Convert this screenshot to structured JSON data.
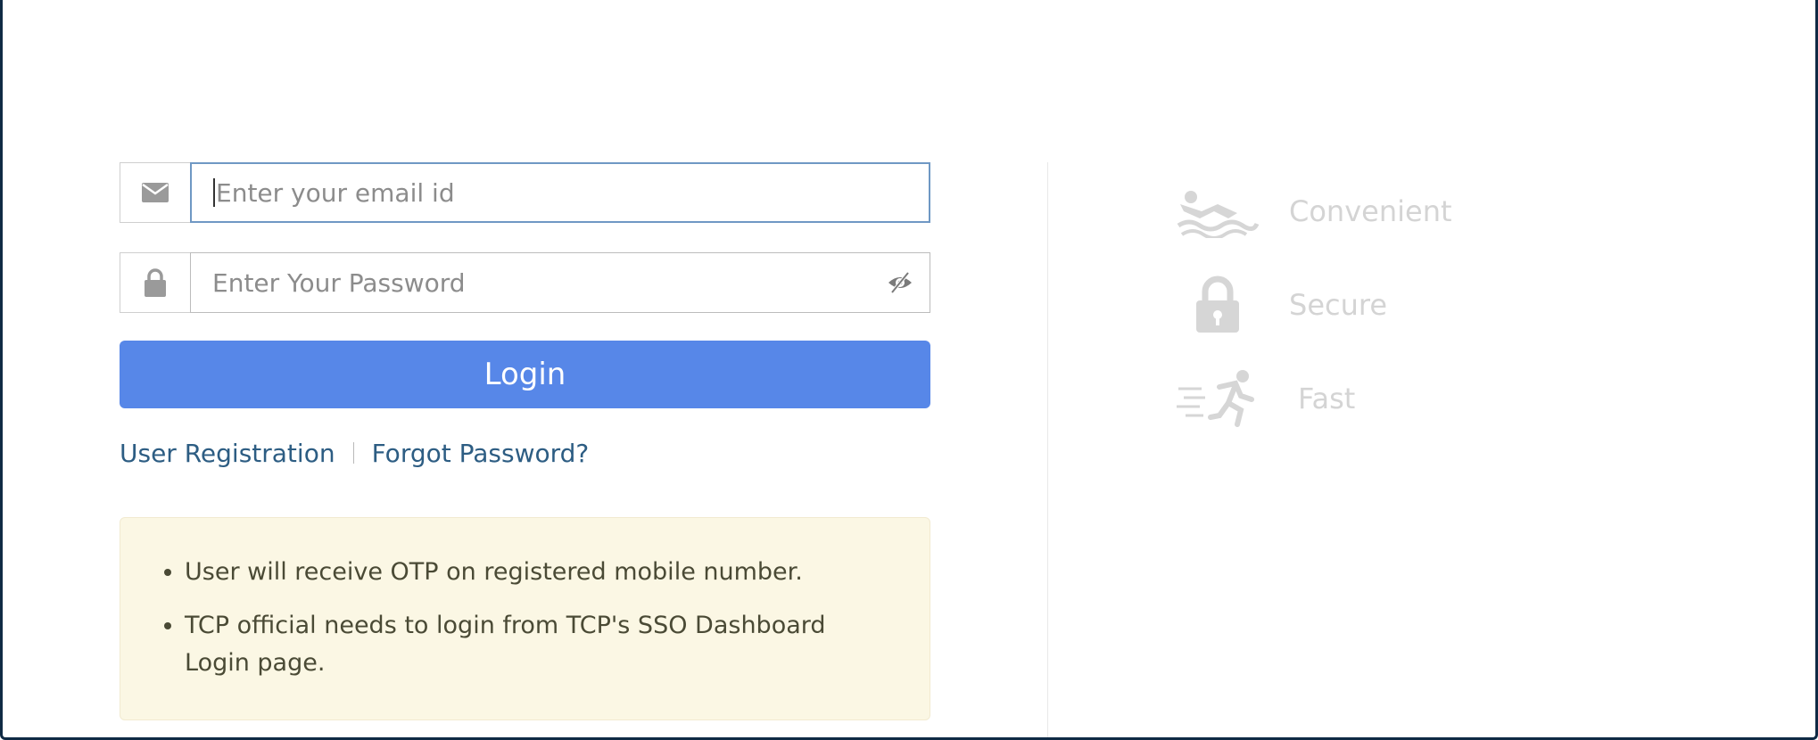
{
  "form": {
    "email_placeholder": "Enter your email id",
    "password_placeholder": "Enter Your Password",
    "login_label": "Login"
  },
  "links": {
    "registration": "User Registration",
    "forgot_password": "Forgot Password?"
  },
  "info": {
    "items": [
      "User will receive OTP on registered mobile number.",
      "TCP official needs to login from TCP's SSO Dashboard Login page."
    ]
  },
  "features": [
    {
      "label": "Convenient",
      "icon": "swimmer-icon"
    },
    {
      "label": "Secure",
      "icon": "padlock-icon"
    },
    {
      "label": "Fast",
      "icon": "runner-icon"
    }
  ],
  "colors": {
    "button": "#5787e8",
    "link": "#2d5d83",
    "info_background": "#fbf7e4",
    "feature_text": "#d4d4d4"
  }
}
